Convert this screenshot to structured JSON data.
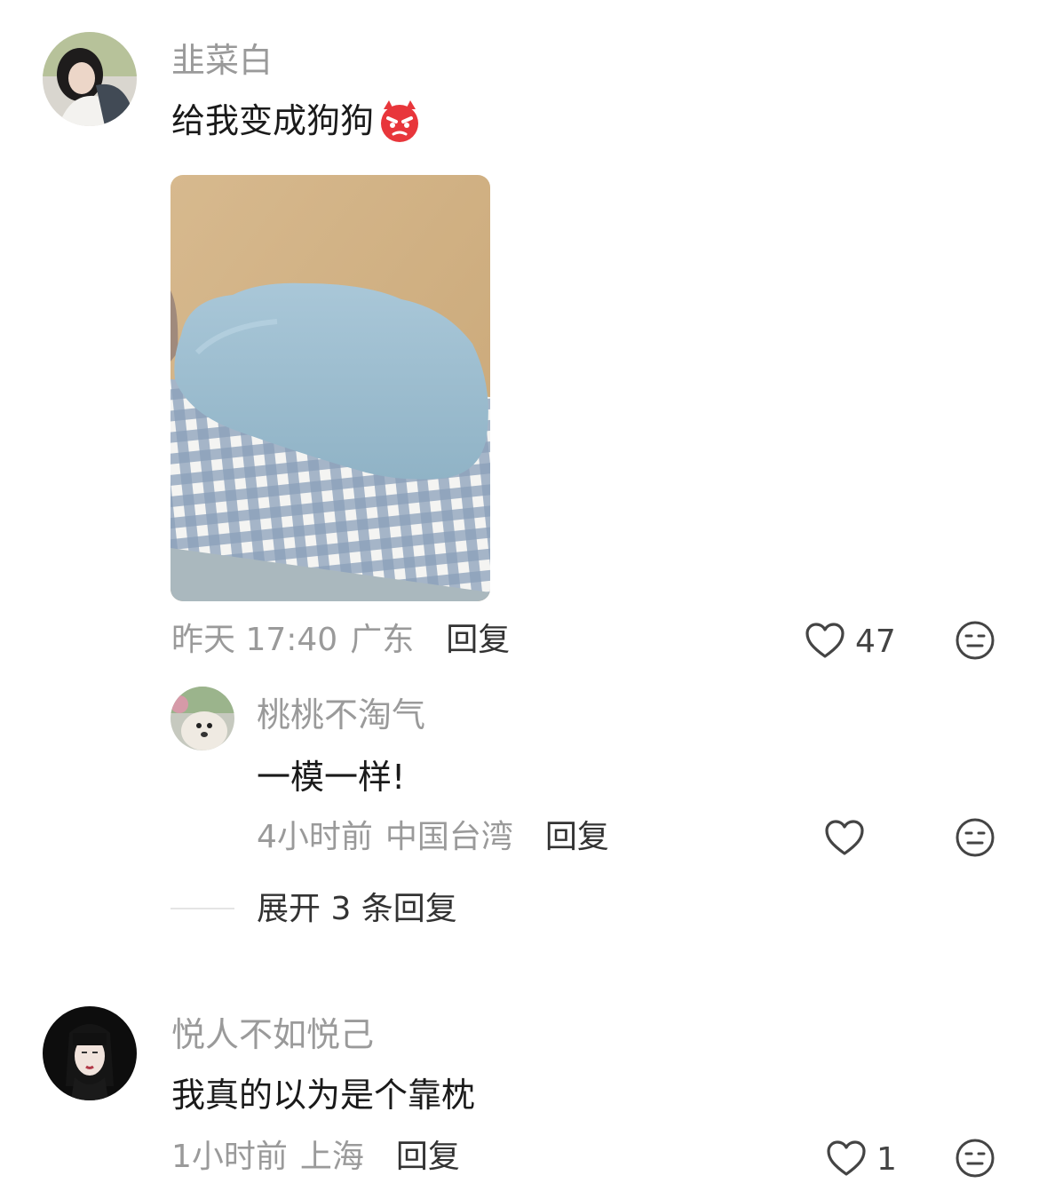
{
  "comments": [
    {
      "username": "韭菜白",
      "text": "给我变成狗狗",
      "emoji": "angry-devil-emoji",
      "time": "昨天 17:40",
      "location": "广东",
      "reply_label": "回复",
      "likes": "47",
      "replies": [
        {
          "username": "桃桃不淘气",
          "text": "一模一样!",
          "time": "4小时前",
          "location": "中国台湾",
          "reply_label": "回复",
          "likes": ""
        }
      ],
      "expand_label": "展开 3 条回复"
    },
    {
      "username": "悦人不如悦己",
      "text": "我真的以为是个靠枕",
      "time": "1小时前",
      "location": "上海",
      "reply_label": "回复",
      "likes": "1"
    }
  ],
  "icons": {
    "like": "heart-outline-icon",
    "dislike": "unamused-face-icon"
  },
  "colors": {
    "meta_text": "#9a9a9a",
    "body_text": "#1a1a1a",
    "icon_stroke": "#444444"
  }
}
